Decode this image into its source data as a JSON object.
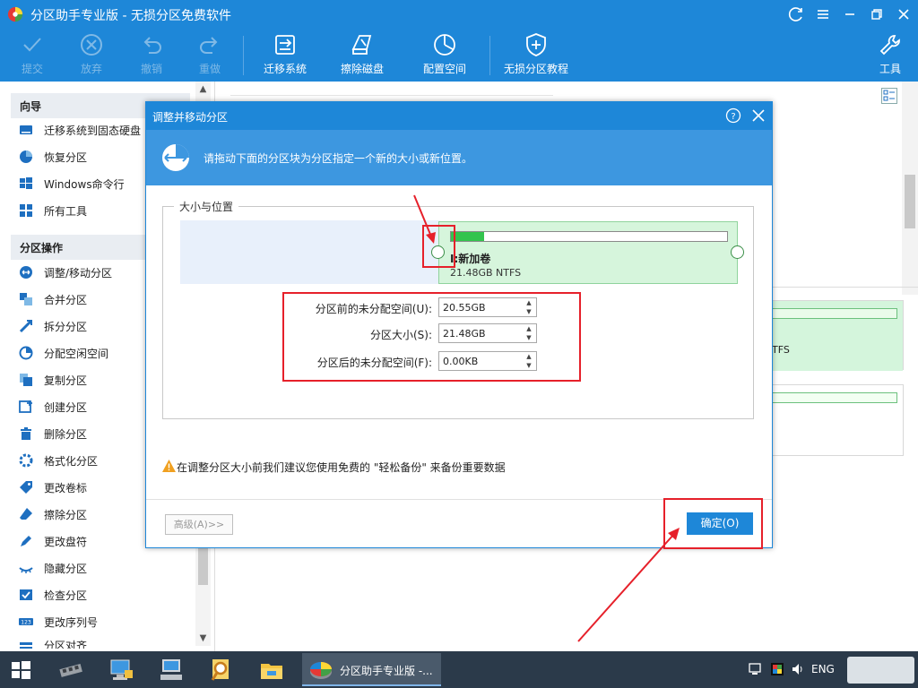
{
  "window": {
    "title": "分区助手专业版 - 无损分区免费软件"
  },
  "toolbar": {
    "items": [
      {
        "label": "提交",
        "icon": "check-icon",
        "enabled": false
      },
      {
        "label": "放弃",
        "icon": "discard-icon",
        "enabled": false
      },
      {
        "label": "撤销",
        "icon": "undo-icon",
        "enabled": false
      },
      {
        "label": "重做",
        "icon": "redo-icon",
        "enabled": false
      },
      {
        "label": "迁移系统",
        "icon": "migrate-os-icon",
        "enabled": true
      },
      {
        "label": "擦除磁盘",
        "icon": "wipe-disk-icon",
        "enabled": true
      },
      {
        "label": "配置空间",
        "icon": "allocate-space-icon",
        "enabled": true
      },
      {
        "label": "无损分区教程",
        "icon": "shield-icon",
        "enabled": true
      },
      {
        "label": "工具",
        "icon": "wrench-icon",
        "enabled": true
      }
    ]
  },
  "sidebar": {
    "wizard_heading": "向导",
    "wizard_items": [
      {
        "label": "迁移系统到固态硬盘",
        "icon": "migrate-ssd-icon"
      },
      {
        "label": "恢复分区",
        "icon": "recover-icon"
      },
      {
        "label": "Windows命令行",
        "icon": "windows-icon"
      },
      {
        "label": "所有工具",
        "icon": "all-tools-icon"
      }
    ],
    "ops_heading": "分区操作",
    "ops_items": [
      {
        "label": "调整/移动分区",
        "icon": "resize-icon"
      },
      {
        "label": "合并分区",
        "icon": "merge-icon"
      },
      {
        "label": "拆分分区",
        "icon": "split-icon"
      },
      {
        "label": "分配空闲空间",
        "icon": "allocate-icon"
      },
      {
        "label": "复制分区",
        "icon": "copy-icon"
      },
      {
        "label": "创建分区",
        "icon": "create-icon"
      },
      {
        "label": "删除分区",
        "icon": "delete-icon"
      },
      {
        "label": "格式化分区",
        "icon": "format-icon"
      },
      {
        "label": "更改卷标",
        "icon": "label-icon"
      },
      {
        "label": "擦除分区",
        "icon": "wipe-icon"
      },
      {
        "label": "更改盘符",
        "icon": "drive-letter-icon"
      },
      {
        "label": "隐藏分区",
        "icon": "hide-icon"
      },
      {
        "label": "检查分区",
        "icon": "check-partition-icon"
      },
      {
        "label": "更改序列号",
        "icon": "serial-icon"
      },
      {
        "label": "分区对齐",
        "icon": "align-icon"
      }
    ]
  },
  "background": {
    "panel_text": "TFS"
  },
  "dialog": {
    "title": "调整并移动分区",
    "banner_text": "请拖动下面的分区块为分区指定一个新的大小或新位置。",
    "group_label": "大小与位置",
    "partition": {
      "name": "I:新加卷",
      "size_fs": "21.48GB NTFS",
      "used_fraction": 0.12
    },
    "fields": [
      {
        "label": "分区前的未分配空间(U):",
        "value": "20.55GB"
      },
      {
        "label": "分区大小(S):",
        "value": "21.48GB"
      },
      {
        "label": "分区后的未分配空间(F):",
        "value": "0.00KB"
      }
    ],
    "warning": "在调整分区大小前我们建议您使用免费的 \"轻松备份\" 来备份重要数据",
    "advanced_label": "高级(A)>>",
    "ok_label": "确定(O)"
  },
  "taskbar": {
    "active_app_label": "分区助手专业版 -...",
    "language": "ENG"
  },
  "colors": {
    "accent": "#1e87d8",
    "partition_fill": "#d6f5dc",
    "annotation_red": "#e6202a"
  }
}
